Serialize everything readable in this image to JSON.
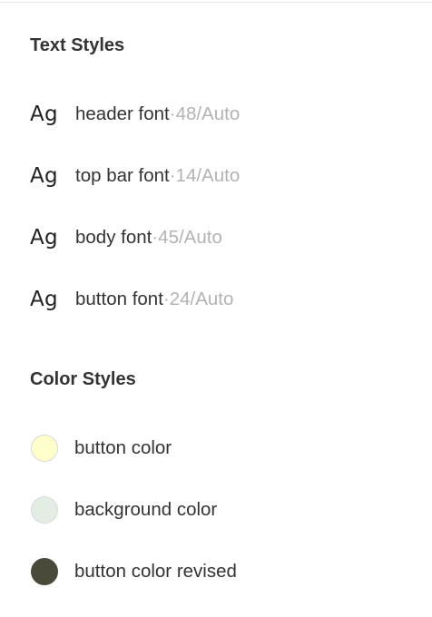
{
  "text_styles": {
    "title": "Text Styles",
    "icon_glyph": "Ag",
    "items": [
      {
        "name": "header font",
        "meta": "48/Auto"
      },
      {
        "name": "top bar font",
        "meta": "14/Auto"
      },
      {
        "name": "body font",
        "meta": "45/Auto"
      },
      {
        "name": "button font",
        "meta": "24/Auto"
      }
    ],
    "separator": " · "
  },
  "color_styles": {
    "title": "Color Styles",
    "items": [
      {
        "name": "button color",
        "color": "#ffffcc"
      },
      {
        "name": "background color",
        "color": "#e3ede3"
      },
      {
        "name": "button color revised",
        "color": "#4a4a3a"
      }
    ]
  }
}
